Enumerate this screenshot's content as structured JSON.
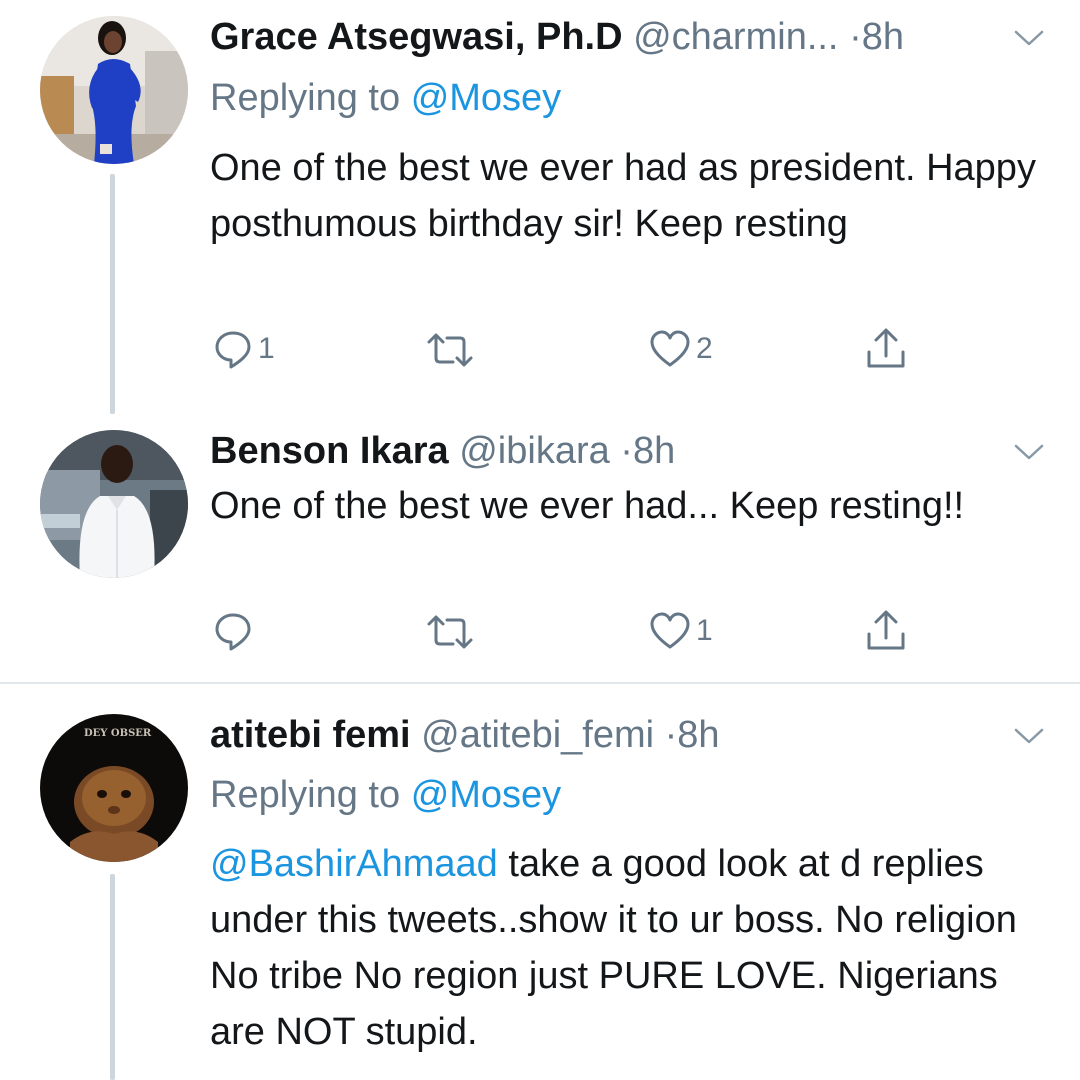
{
  "tweets": [
    {
      "name": "Grace Atsegwasi, Ph.D",
      "handle": "@charmin...",
      "separator": "·",
      "time": "8h",
      "replying_prefix": "Replying to",
      "replying_to": "@Mosey",
      "text": "One of the best we ever had as president. Happy posthumous birthday sir! Keep resting",
      "replies": "1",
      "retweets": "",
      "likes": "2",
      "avatar": "woman-in-blue-dress-avatar"
    },
    {
      "name": "Benson Ikara",
      "handle": "@ibikara",
      "separator": "·",
      "time": "8h",
      "text": "One of the best we ever had... Keep resting!!",
      "replies": "",
      "retweets": "",
      "likes": "1",
      "avatar": "man-in-white-shirt-avatar"
    },
    {
      "name": "atitebi femi",
      "handle": "@atitebi_femi",
      "separator": "·",
      "time": "8h",
      "replying_prefix": "Replying to",
      "replying_to": "@Mosey",
      "mention": "@BashirAhmaad",
      "text": " take a good look at d replies under this tweets..show it to ur boss. No religion No tribe No region just PURE LOVE. Nigerians are NOT stupid.",
      "avatar": "baby-photo-avatar",
      "avatar_caption": "DEY OBSER"
    }
  ],
  "icons": {
    "reply": "reply-icon",
    "retweet": "retweet-icon",
    "like": "heart-icon",
    "share": "share-icon",
    "more": "chevron-down-icon"
  },
  "colors": {
    "text": "#14171a",
    "secondary": "#657786",
    "link": "#1b95e0",
    "thread_line": "#cdd6dd",
    "divider": "#e1e8ed"
  }
}
